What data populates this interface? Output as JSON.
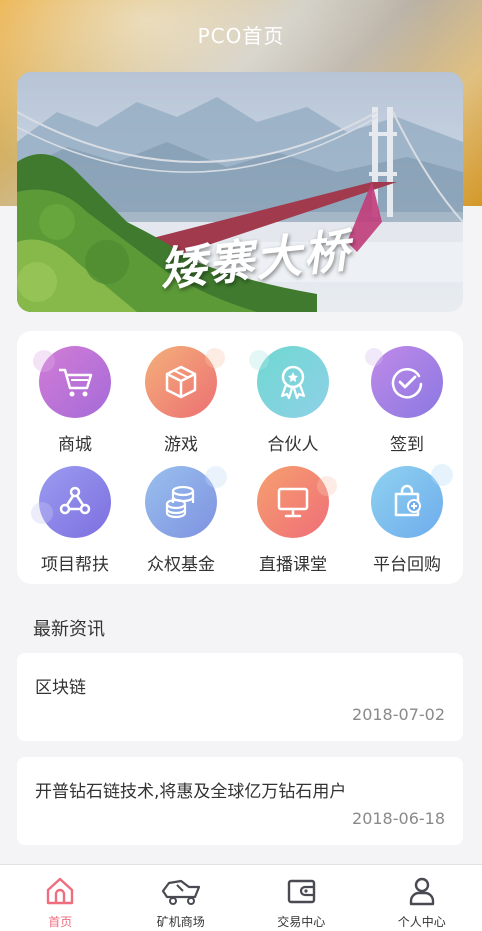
{
  "page": {
    "title": "PCO首页"
  },
  "banner": {
    "caption": "矮寨大桥",
    "dot_count": 4,
    "active_dot": 3
  },
  "grid": {
    "items": [
      {
        "label": "商城",
        "icon": "shopping-cart-icon",
        "color_a": "#d27cd6",
        "color_b": "#a56bd8"
      },
      {
        "label": "游戏",
        "icon": "box-icon",
        "color_a": "#f4b07a",
        "color_b": "#ec6f73"
      },
      {
        "label": "合伙人",
        "icon": "award-ribbon-icon",
        "color_a": "#6fd8d0",
        "color_b": "#8fd0e8"
      },
      {
        "label": "签到",
        "icon": "checkmark-circle-icon",
        "color_a": "#c08ae8",
        "color_b": "#8a78e2"
      },
      {
        "label": "项目帮扶",
        "icon": "share-nodes-icon",
        "color_a": "#9a9cf0",
        "color_b": "#7e6fe0"
      },
      {
        "label": "众权基金",
        "icon": "coin-stack-icon",
        "color_a": "#9ac0ee",
        "color_b": "#7e92e0"
      },
      {
        "label": "直播课堂",
        "icon": "monitor-icon",
        "color_a": "#f6a06f",
        "color_b": "#ef6e78"
      },
      {
        "label": "平台回购",
        "icon": "shopping-bag-icon",
        "color_a": "#8fd2f0",
        "color_b": "#6eacec"
      }
    ]
  },
  "news": {
    "heading": "最新资讯",
    "items": [
      {
        "title": "区块链",
        "date": "2018-07-02"
      },
      {
        "title": "开普钻石链技术,将惠及全球亿万钻石用户",
        "date": "2018-06-18"
      }
    ]
  },
  "tabbar": {
    "items": [
      {
        "label": "首页",
        "icon": "home-icon",
        "active": true
      },
      {
        "label": "矿机商场",
        "icon": "mining-cart-icon",
        "active": false
      },
      {
        "label": "交易中心",
        "icon": "wallet-icon",
        "active": false
      },
      {
        "label": "个人中心",
        "icon": "user-icon",
        "active": false
      }
    ]
  },
  "colors": {
    "accent": "#ef6d7f",
    "header_gold": "#e8a020"
  }
}
